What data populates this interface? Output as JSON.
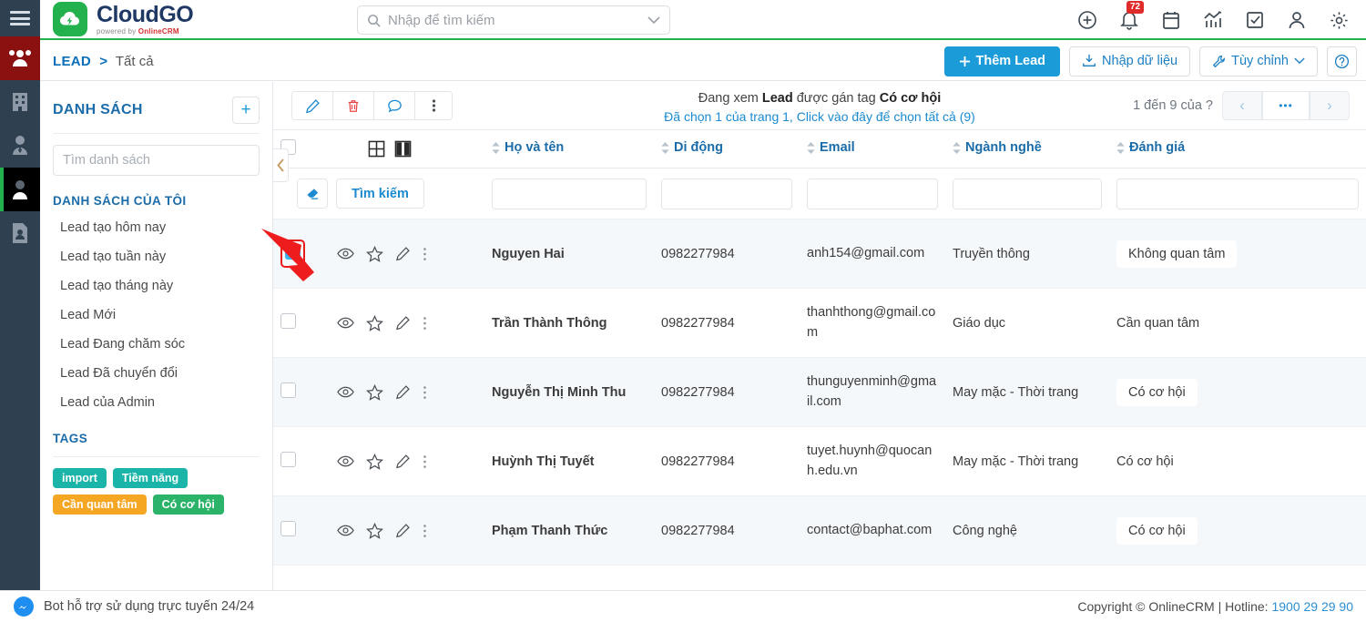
{
  "brand": {
    "name": "CloudGO",
    "powered_prefix": "powered by ",
    "powered_brand": "OnlineCRM"
  },
  "search": {
    "placeholder": "Nhập để tìm kiếm",
    "value": ""
  },
  "header_icons": [
    {
      "name": "add-circle-icon",
      "label": "add"
    },
    {
      "name": "bell-icon",
      "label": "notifications",
      "badge": "72"
    },
    {
      "name": "calendar-icon",
      "label": "calendar"
    },
    {
      "name": "analytics-icon",
      "label": "reports"
    },
    {
      "name": "task-check-icon",
      "label": "tasks"
    },
    {
      "name": "user-icon",
      "label": "account"
    },
    {
      "name": "gear-icon",
      "label": "settings"
    }
  ],
  "breadcrumb": {
    "module": "LEAD",
    "separator": ">",
    "current": "Tất cả"
  },
  "crumb_actions": {
    "add_lead": "Thêm Lead",
    "import": "Nhập dữ liệu",
    "customize": "Tùy chỉnh",
    "help": "?"
  },
  "sidebar": {
    "title": "DANH SÁCH",
    "add_button": "+",
    "search_placeholder": "Tìm danh sách",
    "section_title": "DANH SÁCH CỦA TÔI",
    "items": [
      {
        "label": "Lead tạo hôm nay"
      },
      {
        "label": "Lead tạo tuần này"
      },
      {
        "label": "Lead tạo tháng này"
      },
      {
        "label": "Lead Mới"
      },
      {
        "label": "Lead Đang chăm sóc"
      },
      {
        "label": "Lead Đã chuyển đổi"
      },
      {
        "label": "Lead của Admin"
      }
    ],
    "tags_title": "TAGS",
    "tags": [
      {
        "label": "import",
        "color": "#1ab5a8"
      },
      {
        "label": "Tiềm năng",
        "color": "#1ab5a8"
      },
      {
        "label": "Cần quan tâm",
        "color": "#f5a623"
      },
      {
        "label": "Có cơ hội",
        "color": "#2cb36a"
      }
    ]
  },
  "toolbar": {
    "buttons": [
      {
        "name": "edit-icon",
        "label": "Sửa"
      },
      {
        "name": "delete-icon",
        "label": "Xóa"
      },
      {
        "name": "comment-icon",
        "label": "Bình luận"
      },
      {
        "name": "more-vertical-icon",
        "label": "Thêm"
      }
    ],
    "viewing_prefix": "Đang xem ",
    "viewing_entity": "Lead",
    "viewing_mid": " được gán tag ",
    "viewing_tag": "Có cơ hội",
    "selection_note": "Đã chọn 1 của trang 1, Click vào đây để chọn tất cả (9)"
  },
  "pager": {
    "range_label": "1 đến 9 của",
    "total": "?",
    "prev": "‹",
    "more": "•••",
    "next": "›"
  },
  "table": {
    "view_icons": [
      {
        "name": "grid-view-icon"
      },
      {
        "name": "split-view-icon"
      }
    ],
    "columns": [
      {
        "key": "name",
        "label": "Họ và tên"
      },
      {
        "key": "mobile",
        "label": "Di động"
      },
      {
        "key": "email",
        "label": "Email"
      },
      {
        "key": "industry",
        "label": "Ngành nghề"
      },
      {
        "key": "rating",
        "label": "Đánh giá"
      }
    ],
    "filter": {
      "clear_label": "clear-filter",
      "search_label": "Tìm kiếm",
      "values": {
        "name": "",
        "mobile": "",
        "email": "",
        "industry": "",
        "rating": ""
      }
    },
    "rows": [
      {
        "checked": true,
        "name": "Nguyen Hai",
        "mobile": "0982277984",
        "email": "anh154@gmail.com",
        "industry": "Truyền thông",
        "rating": "Không quan tâm",
        "rating_pill": true
      },
      {
        "checked": false,
        "name": "Trần Thành Thông",
        "mobile": "0982277984",
        "email": "thanhthong@gmail.com",
        "industry": "Giáo dục",
        "rating": "Cần quan tâm",
        "rating_pill": false
      },
      {
        "checked": false,
        "name": "Nguyễn Thị Minh Thu",
        "mobile": "0982277984",
        "email": "thunguyenminh@gmail.com",
        "industry": "May mặc - Thời trang",
        "rating": "Có cơ hội",
        "rating_pill": true
      },
      {
        "checked": false,
        "name": "Huỳnh Thị Tuyết",
        "mobile": "0982277984",
        "email": "tuyet.huynh@quocanh.edu.vn",
        "industry": "May mặc - Thời trang",
        "rating": "Có cơ hội",
        "rating_pill": false
      },
      {
        "checked": false,
        "name": "Phạm Thanh Thức",
        "mobile": "0982277984",
        "email": "contact@baphat.com",
        "industry": "Công nghệ",
        "rating": "Có cơ hội",
        "rating_pill": true
      }
    ]
  },
  "footer": {
    "bot_text": "Bot hỗ trợ sử dụng trực tuyến 24/24",
    "copyright": "Copyright © OnlineCRM | Hotline: ",
    "hotline": "1900 29 29 90"
  },
  "colors": {
    "accent_blue": "#1b9bd8",
    "brand_green": "#22b14c",
    "rail_dark": "#2f4050",
    "rail_red": "#8b1010",
    "link_blue": "#1b7fc4",
    "annotation_red": "#e81b1b"
  }
}
